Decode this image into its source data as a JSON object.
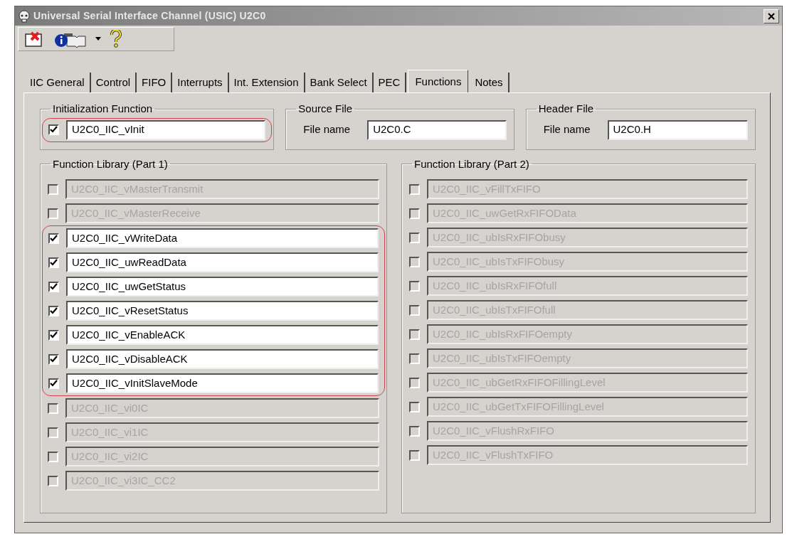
{
  "window": {
    "title": "Universal Serial Interface Channel (USIC) U2C0"
  },
  "tabs": [
    {
      "label": "IIC General",
      "selected": false
    },
    {
      "label": "Control",
      "selected": false
    },
    {
      "label": "FIFO",
      "selected": false
    },
    {
      "label": "Interrupts",
      "selected": false
    },
    {
      "label": "Int. Extension",
      "selected": false
    },
    {
      "label": "Bank Select",
      "selected": false
    },
    {
      "label": "PEC",
      "selected": false
    },
    {
      "label": "Functions",
      "selected": true
    },
    {
      "label": "Notes",
      "selected": false
    }
  ],
  "initialization": {
    "title": "Initialization Function",
    "checked": true,
    "value": "U2C0_IIC_vInit",
    "highlighted": true
  },
  "source_file": {
    "title": "Source File",
    "label": "File name",
    "value": "U2C0.C"
  },
  "header_file": {
    "title": "Header File",
    "label": "File name",
    "value": "U2C0.H"
  },
  "library_part1": {
    "title": "Function Library (Part 1)",
    "items": [
      {
        "label": "U2C0_IIC_vMasterTransmit",
        "checked": false,
        "enabled": false
      },
      {
        "label": "U2C0_IIC_vMasterReceive",
        "checked": false,
        "enabled": false
      },
      {
        "label": "U2C0_IIC_vWriteData",
        "checked": true,
        "enabled": true
      },
      {
        "label": "U2C0_IIC_uwReadData",
        "checked": true,
        "enabled": true
      },
      {
        "label": "U2C0_IIC_uwGetStatus",
        "checked": true,
        "enabled": true
      },
      {
        "label": "U2C0_IIC_vResetStatus",
        "checked": true,
        "enabled": true
      },
      {
        "label": "U2C0_IIC_vEnableACK",
        "checked": true,
        "enabled": true
      },
      {
        "label": "U2C0_IIC_vDisableACK",
        "checked": true,
        "enabled": true
      },
      {
        "label": "U2C0_IIC_vInitSlaveMode",
        "checked": true,
        "enabled": true
      },
      {
        "label": "U2C0_IIC_vi0IC",
        "checked": false,
        "enabled": false
      },
      {
        "label": "U2C0_IIC_vi1IC",
        "checked": false,
        "enabled": false
      },
      {
        "label": "U2C0_IIC_vi2IC",
        "checked": false,
        "enabled": false
      },
      {
        "label": "U2C0_IIC_vi3IC_CC2",
        "checked": false,
        "enabled": false
      }
    ]
  },
  "library_part2": {
    "title": "Function Library (Part 2)",
    "items": [
      {
        "label": "U2C0_IIC_vFillTxFIFO",
        "checked": false,
        "enabled": false
      },
      {
        "label": "U2C0_IIC_uwGetRxFIFOData",
        "checked": false,
        "enabled": false
      },
      {
        "label": "U2C0_IIC_ubIsRxFIFObusy",
        "checked": false,
        "enabled": false
      },
      {
        "label": "U2C0_IIC_ubIsTxFIFObusy",
        "checked": false,
        "enabled": false
      },
      {
        "label": "U2C0_IIC_ubIsRxFIFOfull",
        "checked": false,
        "enabled": false
      },
      {
        "label": "U2C0_IIC_ubIsTxFIFOfull",
        "checked": false,
        "enabled": false
      },
      {
        "label": "U2C0_IIC_ubIsRxFIFOempty",
        "checked": false,
        "enabled": false
      },
      {
        "label": "U2C0_IIC_ubIsTxFIFOempty",
        "checked": false,
        "enabled": false
      },
      {
        "label": "U2C0_IIC_ubGetRxFIFOFillingLevel",
        "checked": false,
        "enabled": false
      },
      {
        "label": "U2C0_IIC_ubGetTxFIFOFillingLevel",
        "checked": false,
        "enabled": false
      },
      {
        "label": "U2C0_IIC_vFlushRxFIFO",
        "checked": false,
        "enabled": false
      },
      {
        "label": "U2C0_IIC_vFlushTxFIFO",
        "checked": false,
        "enabled": false
      }
    ]
  }
}
